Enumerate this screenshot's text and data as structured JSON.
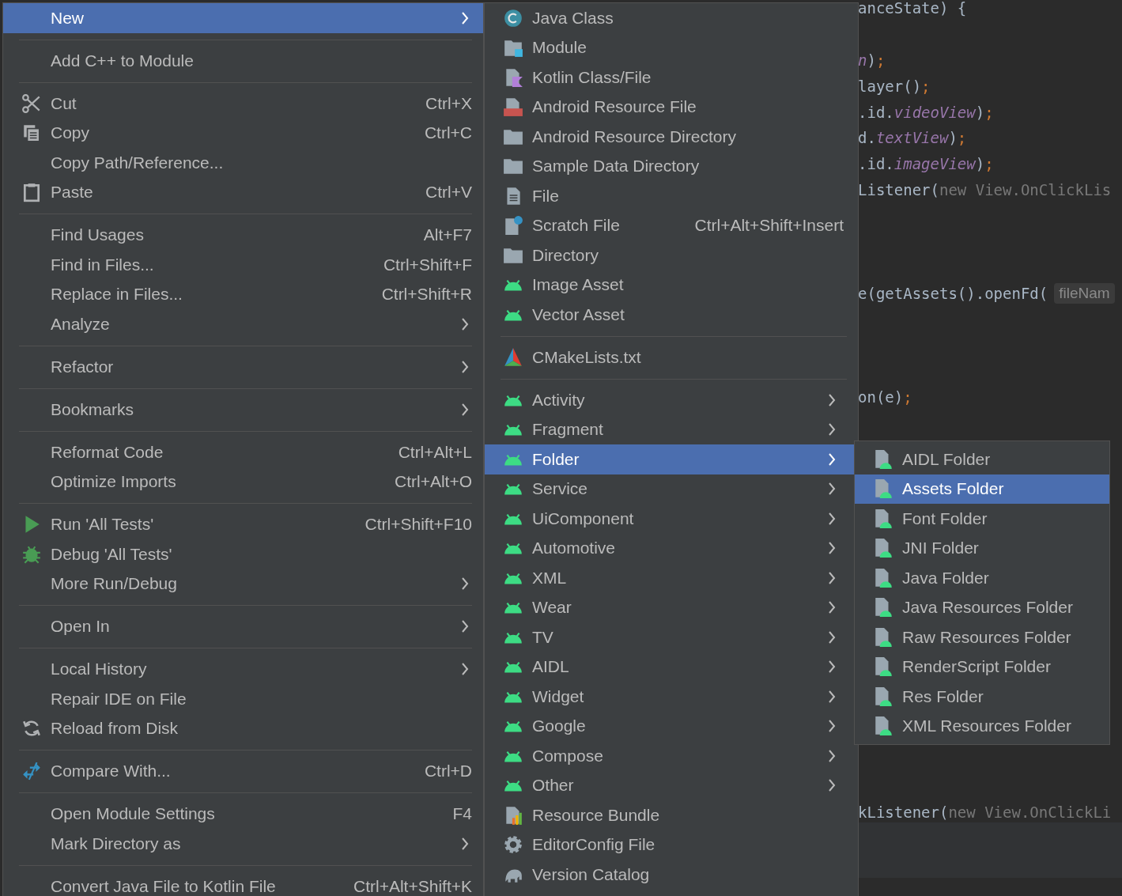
{
  "editor": {
    "lines": [
      {
        "segments": [
          {
            "kind": "plain",
            "text": "anceState) {"
          }
        ]
      },
      {
        "segments": [
          {
            "kind": "field",
            "text": "n"
          },
          {
            "kind": "plain",
            "text": ")"
          },
          {
            "kind": "semi",
            "text": ";"
          }
        ]
      },
      {
        "segments": [
          {
            "kind": "plain",
            "text": "layer()"
          },
          {
            "kind": "semi",
            "text": ";"
          }
        ]
      },
      {
        "segments": [
          {
            "kind": "plain",
            "text": ".id."
          },
          {
            "kind": "field",
            "text": "videoView"
          },
          {
            "kind": "plain",
            "text": ")"
          },
          {
            "kind": "semi",
            "text": ";"
          }
        ]
      },
      {
        "segments": [
          {
            "kind": "plain",
            "text": "d."
          },
          {
            "kind": "field",
            "text": "textView"
          },
          {
            "kind": "plain",
            "text": ")"
          },
          {
            "kind": "semi",
            "text": ";"
          }
        ]
      },
      {
        "segments": [
          {
            "kind": "plain",
            "text": ".id."
          },
          {
            "kind": "field",
            "text": "imageView"
          },
          {
            "kind": "plain",
            "text": ")"
          },
          {
            "kind": "semi",
            "text": ";"
          }
        ]
      },
      {
        "segments": [
          {
            "kind": "plain",
            "text": "Listener("
          },
          {
            "kind": "faded",
            "text": "new View.OnClickLis"
          }
        ]
      },
      {
        "segments": [
          {
            "kind": "plain",
            "text": "e(getAssets().openFd("
          },
          {
            "kind": "hint",
            "text": "fileNam"
          }
        ]
      },
      {
        "segments": [
          {
            "kind": "plain",
            "text": "on(e)"
          },
          {
            "kind": "semi",
            "text": ";"
          }
        ]
      },
      {
        "segments": [
          {
            "kind": "plain",
            "text": "kListener("
          },
          {
            "kind": "faded",
            "text": "new View.OnClickLi"
          }
        ]
      }
    ]
  },
  "menus": [
    {
      "items": [
        {
          "kind": "item",
          "label": "New",
          "selected": true,
          "submenu": true
        },
        {
          "kind": "separator"
        },
        {
          "kind": "item",
          "label": "Add C++ to Module",
          "selected": false,
          "submenu": false
        },
        {
          "kind": "separator"
        },
        {
          "kind": "item",
          "label": "Cut",
          "shortcut": "Ctrl+X",
          "selected": false,
          "submenu": false
        },
        {
          "kind": "item",
          "label": "Copy",
          "shortcut": "Ctrl+C",
          "selected": false,
          "submenu": false
        },
        {
          "kind": "item",
          "label": "Copy Path/Reference...",
          "selected": false,
          "submenu": false
        },
        {
          "kind": "item",
          "label": "Paste",
          "shortcut": "Ctrl+V",
          "selected": false,
          "submenu": false
        },
        {
          "kind": "separator"
        },
        {
          "kind": "item",
          "label": "Find Usages",
          "shortcut": "Alt+F7",
          "selected": false,
          "submenu": false
        },
        {
          "kind": "item",
          "label": "Find in Files...",
          "shortcut": "Ctrl+Shift+F",
          "selected": false,
          "submenu": false
        },
        {
          "kind": "item",
          "label": "Replace in Files...",
          "shortcut": "Ctrl+Shift+R",
          "selected": false,
          "submenu": false
        },
        {
          "kind": "item",
          "label": "Analyze",
          "selected": false,
          "submenu": true
        },
        {
          "kind": "separator"
        },
        {
          "kind": "item",
          "label": "Refactor",
          "selected": false,
          "submenu": true
        },
        {
          "kind": "separator"
        },
        {
          "kind": "item",
          "label": "Bookmarks",
          "selected": false,
          "submenu": true
        },
        {
          "kind": "separator"
        },
        {
          "kind": "item",
          "label": "Reformat Code",
          "shortcut": "Ctrl+Alt+L",
          "selected": false,
          "submenu": false
        },
        {
          "kind": "item",
          "label": "Optimize Imports",
          "shortcut": "Ctrl+Alt+O",
          "selected": false,
          "submenu": false
        },
        {
          "kind": "separator"
        },
        {
          "kind": "item",
          "label": "Run 'All Tests'",
          "shortcut": "Ctrl+Shift+F10",
          "selected": false,
          "submenu": false
        },
        {
          "kind": "item",
          "label": "Debug 'All Tests'",
          "selected": false,
          "submenu": false
        },
        {
          "kind": "item",
          "label": "More Run/Debug",
          "selected": false,
          "submenu": true
        },
        {
          "kind": "separator"
        },
        {
          "kind": "item",
          "label": "Open In",
          "selected": false,
          "submenu": true
        },
        {
          "kind": "separator"
        },
        {
          "kind": "item",
          "label": "Local History",
          "selected": false,
          "submenu": true
        },
        {
          "kind": "item",
          "label": "Repair IDE on File",
          "selected": false,
          "submenu": false
        },
        {
          "kind": "item",
          "label": "Reload from Disk",
          "selected": false,
          "submenu": false
        },
        {
          "kind": "separator"
        },
        {
          "kind": "item",
          "label": "Compare With...",
          "shortcut": "Ctrl+D",
          "selected": false,
          "submenu": false
        },
        {
          "kind": "separator"
        },
        {
          "kind": "item",
          "label": "Open Module Settings",
          "shortcut": "F4",
          "selected": false,
          "submenu": false
        },
        {
          "kind": "item",
          "label": "Mark Directory as",
          "selected": false,
          "submenu": true
        },
        {
          "kind": "separator"
        },
        {
          "kind": "item",
          "label": "Convert Java File to Kotlin File",
          "shortcut": "Ctrl+Alt+Shift+K",
          "selected": false,
          "submenu": false
        }
      ]
    },
    {
      "items": [
        {
          "kind": "item",
          "label": "Java Class",
          "selected": false,
          "submenu": false
        },
        {
          "kind": "item",
          "label": "Module",
          "selected": false,
          "submenu": false
        },
        {
          "kind": "item",
          "label": "Kotlin Class/File",
          "selected": false,
          "submenu": false
        },
        {
          "kind": "item",
          "label": "Android Resource File",
          "selected": false,
          "submenu": false
        },
        {
          "kind": "item",
          "label": "Android Resource Directory",
          "selected": false,
          "submenu": false
        },
        {
          "kind": "item",
          "label": "Sample Data Directory",
          "selected": false,
          "submenu": false
        },
        {
          "kind": "item",
          "label": "File",
          "selected": false,
          "submenu": false
        },
        {
          "kind": "item",
          "label": "Scratch File",
          "shortcut": "Ctrl+Alt+Shift+Insert",
          "selected": false,
          "submenu": false
        },
        {
          "kind": "item",
          "label": "Directory",
          "selected": false,
          "submenu": false
        },
        {
          "kind": "item",
          "label": "Image Asset",
          "selected": false,
          "submenu": false
        },
        {
          "kind": "item",
          "label": "Vector Asset",
          "selected": false,
          "submenu": false
        },
        {
          "kind": "separator"
        },
        {
          "kind": "item",
          "label": "CMakeLists.txt",
          "selected": false,
          "submenu": false
        },
        {
          "kind": "separator"
        },
        {
          "kind": "item",
          "label": "Activity",
          "selected": false,
          "submenu": true
        },
        {
          "kind": "item",
          "label": "Fragment",
          "selected": false,
          "submenu": true
        },
        {
          "kind": "item",
          "label": "Folder",
          "selected": true,
          "submenu": true
        },
        {
          "kind": "item",
          "label": "Service",
          "selected": false,
          "submenu": true
        },
        {
          "kind": "item",
          "label": "UiComponent",
          "selected": false,
          "submenu": true
        },
        {
          "kind": "item",
          "label": "Automotive",
          "selected": false,
          "submenu": true
        },
        {
          "kind": "item",
          "label": "XML",
          "selected": false,
          "submenu": true
        },
        {
          "kind": "item",
          "label": "Wear",
          "selected": false,
          "submenu": true
        },
        {
          "kind": "item",
          "label": "TV",
          "selected": false,
          "submenu": true
        },
        {
          "kind": "item",
          "label": "AIDL",
          "selected": false,
          "submenu": true
        },
        {
          "kind": "item",
          "label": "Widget",
          "selected": false,
          "submenu": true
        },
        {
          "kind": "item",
          "label": "Google",
          "selected": false,
          "submenu": true
        },
        {
          "kind": "item",
          "label": "Compose",
          "selected": false,
          "submenu": true
        },
        {
          "kind": "item",
          "label": "Other",
          "selected": false,
          "submenu": true
        },
        {
          "kind": "item",
          "label": "Resource Bundle",
          "selected": false,
          "submenu": false
        },
        {
          "kind": "item",
          "label": "EditorConfig File",
          "selected": false,
          "submenu": false
        },
        {
          "kind": "item",
          "label": "Version Catalog",
          "selected": false,
          "submenu": false
        }
      ]
    },
    {
      "items": [
        {
          "kind": "item",
          "label": "AIDL Folder",
          "selected": false,
          "submenu": false
        },
        {
          "kind": "item",
          "label": "Assets Folder",
          "selected": true,
          "submenu": false
        },
        {
          "kind": "item",
          "label": "Font Folder",
          "selected": false,
          "submenu": false
        },
        {
          "kind": "item",
          "label": "JNI Folder",
          "selected": false,
          "submenu": false
        },
        {
          "kind": "item",
          "label": "Java Folder",
          "selected": false,
          "submenu": false
        },
        {
          "kind": "item",
          "label": "Java Resources Folder",
          "selected": false,
          "submenu": false
        },
        {
          "kind": "item",
          "label": "Raw Resources Folder",
          "selected": false,
          "submenu": false
        },
        {
          "kind": "item",
          "label": "RenderScript Folder",
          "selected": false,
          "submenu": false
        },
        {
          "kind": "item",
          "label": "Res Folder",
          "selected": false,
          "submenu": false
        },
        {
          "kind": "item",
          "label": "XML Resources Folder",
          "selected": false,
          "submenu": false
        }
      ]
    }
  ]
}
